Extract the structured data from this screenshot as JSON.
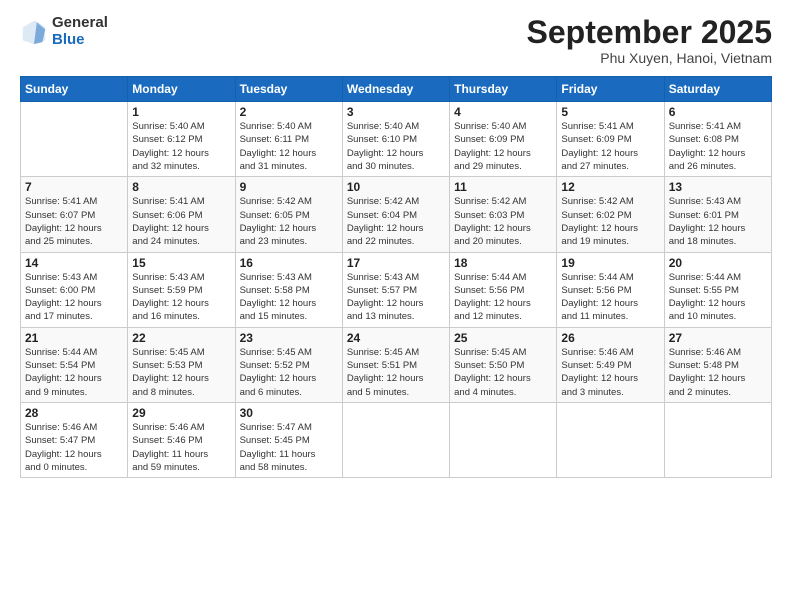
{
  "logo": {
    "general": "General",
    "blue": "Blue"
  },
  "header": {
    "month": "September 2025",
    "location": "Phu Xuyen, Hanoi, Vietnam"
  },
  "weekdays": [
    "Sunday",
    "Monday",
    "Tuesday",
    "Wednesday",
    "Thursday",
    "Friday",
    "Saturday"
  ],
  "weeks": [
    [
      {
        "day": "",
        "info": ""
      },
      {
        "day": "1",
        "info": "Sunrise: 5:40 AM\nSunset: 6:12 PM\nDaylight: 12 hours\nand 32 minutes."
      },
      {
        "day": "2",
        "info": "Sunrise: 5:40 AM\nSunset: 6:11 PM\nDaylight: 12 hours\nand 31 minutes."
      },
      {
        "day": "3",
        "info": "Sunrise: 5:40 AM\nSunset: 6:10 PM\nDaylight: 12 hours\nand 30 minutes."
      },
      {
        "day": "4",
        "info": "Sunrise: 5:40 AM\nSunset: 6:09 PM\nDaylight: 12 hours\nand 29 minutes."
      },
      {
        "day": "5",
        "info": "Sunrise: 5:41 AM\nSunset: 6:09 PM\nDaylight: 12 hours\nand 27 minutes."
      },
      {
        "day": "6",
        "info": "Sunrise: 5:41 AM\nSunset: 6:08 PM\nDaylight: 12 hours\nand 26 minutes."
      }
    ],
    [
      {
        "day": "7",
        "info": "Sunrise: 5:41 AM\nSunset: 6:07 PM\nDaylight: 12 hours\nand 25 minutes."
      },
      {
        "day": "8",
        "info": "Sunrise: 5:41 AM\nSunset: 6:06 PM\nDaylight: 12 hours\nand 24 minutes."
      },
      {
        "day": "9",
        "info": "Sunrise: 5:42 AM\nSunset: 6:05 PM\nDaylight: 12 hours\nand 23 minutes."
      },
      {
        "day": "10",
        "info": "Sunrise: 5:42 AM\nSunset: 6:04 PM\nDaylight: 12 hours\nand 22 minutes."
      },
      {
        "day": "11",
        "info": "Sunrise: 5:42 AM\nSunset: 6:03 PM\nDaylight: 12 hours\nand 20 minutes."
      },
      {
        "day": "12",
        "info": "Sunrise: 5:42 AM\nSunset: 6:02 PM\nDaylight: 12 hours\nand 19 minutes."
      },
      {
        "day": "13",
        "info": "Sunrise: 5:43 AM\nSunset: 6:01 PM\nDaylight: 12 hours\nand 18 minutes."
      }
    ],
    [
      {
        "day": "14",
        "info": "Sunrise: 5:43 AM\nSunset: 6:00 PM\nDaylight: 12 hours\nand 17 minutes."
      },
      {
        "day": "15",
        "info": "Sunrise: 5:43 AM\nSunset: 5:59 PM\nDaylight: 12 hours\nand 16 minutes."
      },
      {
        "day": "16",
        "info": "Sunrise: 5:43 AM\nSunset: 5:58 PM\nDaylight: 12 hours\nand 15 minutes."
      },
      {
        "day": "17",
        "info": "Sunrise: 5:43 AM\nSunset: 5:57 PM\nDaylight: 12 hours\nand 13 minutes."
      },
      {
        "day": "18",
        "info": "Sunrise: 5:44 AM\nSunset: 5:56 PM\nDaylight: 12 hours\nand 12 minutes."
      },
      {
        "day": "19",
        "info": "Sunrise: 5:44 AM\nSunset: 5:56 PM\nDaylight: 12 hours\nand 11 minutes."
      },
      {
        "day": "20",
        "info": "Sunrise: 5:44 AM\nSunset: 5:55 PM\nDaylight: 12 hours\nand 10 minutes."
      }
    ],
    [
      {
        "day": "21",
        "info": "Sunrise: 5:44 AM\nSunset: 5:54 PM\nDaylight: 12 hours\nand 9 minutes."
      },
      {
        "day": "22",
        "info": "Sunrise: 5:45 AM\nSunset: 5:53 PM\nDaylight: 12 hours\nand 8 minutes."
      },
      {
        "day": "23",
        "info": "Sunrise: 5:45 AM\nSunset: 5:52 PM\nDaylight: 12 hours\nand 6 minutes."
      },
      {
        "day": "24",
        "info": "Sunrise: 5:45 AM\nSunset: 5:51 PM\nDaylight: 12 hours\nand 5 minutes."
      },
      {
        "day": "25",
        "info": "Sunrise: 5:45 AM\nSunset: 5:50 PM\nDaylight: 12 hours\nand 4 minutes."
      },
      {
        "day": "26",
        "info": "Sunrise: 5:46 AM\nSunset: 5:49 PM\nDaylight: 12 hours\nand 3 minutes."
      },
      {
        "day": "27",
        "info": "Sunrise: 5:46 AM\nSunset: 5:48 PM\nDaylight: 12 hours\nand 2 minutes."
      }
    ],
    [
      {
        "day": "28",
        "info": "Sunrise: 5:46 AM\nSunset: 5:47 PM\nDaylight: 12 hours\nand 0 minutes."
      },
      {
        "day": "29",
        "info": "Sunrise: 5:46 AM\nSunset: 5:46 PM\nDaylight: 11 hours\nand 59 minutes."
      },
      {
        "day": "30",
        "info": "Sunrise: 5:47 AM\nSunset: 5:45 PM\nDaylight: 11 hours\nand 58 minutes."
      },
      {
        "day": "",
        "info": ""
      },
      {
        "day": "",
        "info": ""
      },
      {
        "day": "",
        "info": ""
      },
      {
        "day": "",
        "info": ""
      }
    ]
  ]
}
